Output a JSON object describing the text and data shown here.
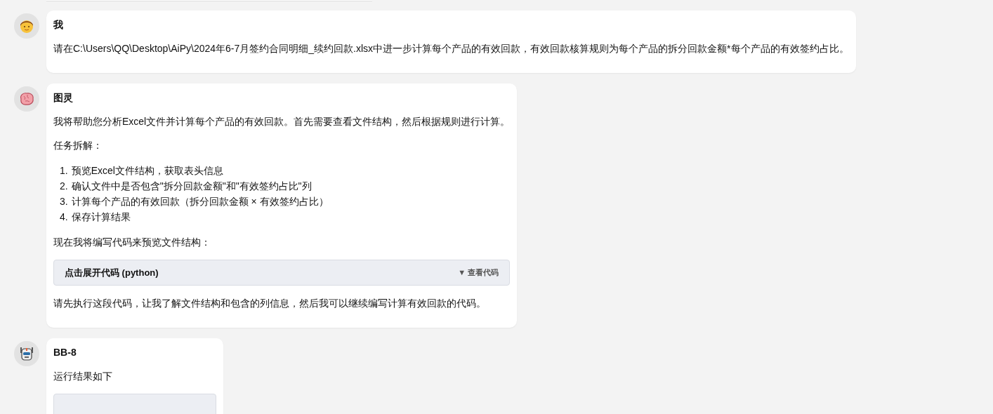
{
  "messages": [
    {
      "sender": "我",
      "avatar": {
        "kind": "person"
      },
      "blocks": [
        {
          "kind": "paragraph",
          "text": "请在C:\\Users\\QQ\\Desktop\\AiPy\\2024年6-7月签约合同明细_续约回款.xlsx中进一步计算每个产品的有效回款，有效回款核算规则为每个产品的拆分回款金额*每个产品的有效签约占比。"
        }
      ]
    },
    {
      "sender": "图灵",
      "avatar": {
        "kind": "brain"
      },
      "blocks": [
        {
          "kind": "paragraph",
          "text": "我将帮助您分析Excel文件并计算每个产品的有效回款。首先需要查看文件结构，然后根据规则进行计算。"
        },
        {
          "kind": "paragraph",
          "text": "任务拆解："
        },
        {
          "kind": "list",
          "items": [
            {
              "number": "1.",
              "text": "预览Excel文件结构，获取表头信息"
            },
            {
              "number": "2.",
              "text": "确认文件中是否包含\"拆分回款金额\"和\"有效签约占比\"列"
            },
            {
              "number": "3.",
              "text": "计算每个产品的有效回款（拆分回款金额 × 有效签约占比）"
            },
            {
              "number": "4.",
              "text": "保存计算结果"
            }
          ]
        },
        {
          "kind": "paragraph",
          "text": "现在我将编写代码来预览文件结构："
        },
        {
          "kind": "code",
          "title": "点击展开代码 (python)",
          "toggle": "▼ 查看代码"
        },
        {
          "kind": "paragraph",
          "text": "请先执行这段代码，让我了解文件结构和包含的列信息，然后我可以继续编写计算有效回款的代码。"
        }
      ]
    },
    {
      "sender": "BB-8",
      "avatar": {
        "kind": "robot"
      },
      "blocks": [
        {
          "kind": "paragraph",
          "text": "运行结果如下"
        },
        {
          "kind": "code"
        }
      ]
    }
  ]
}
